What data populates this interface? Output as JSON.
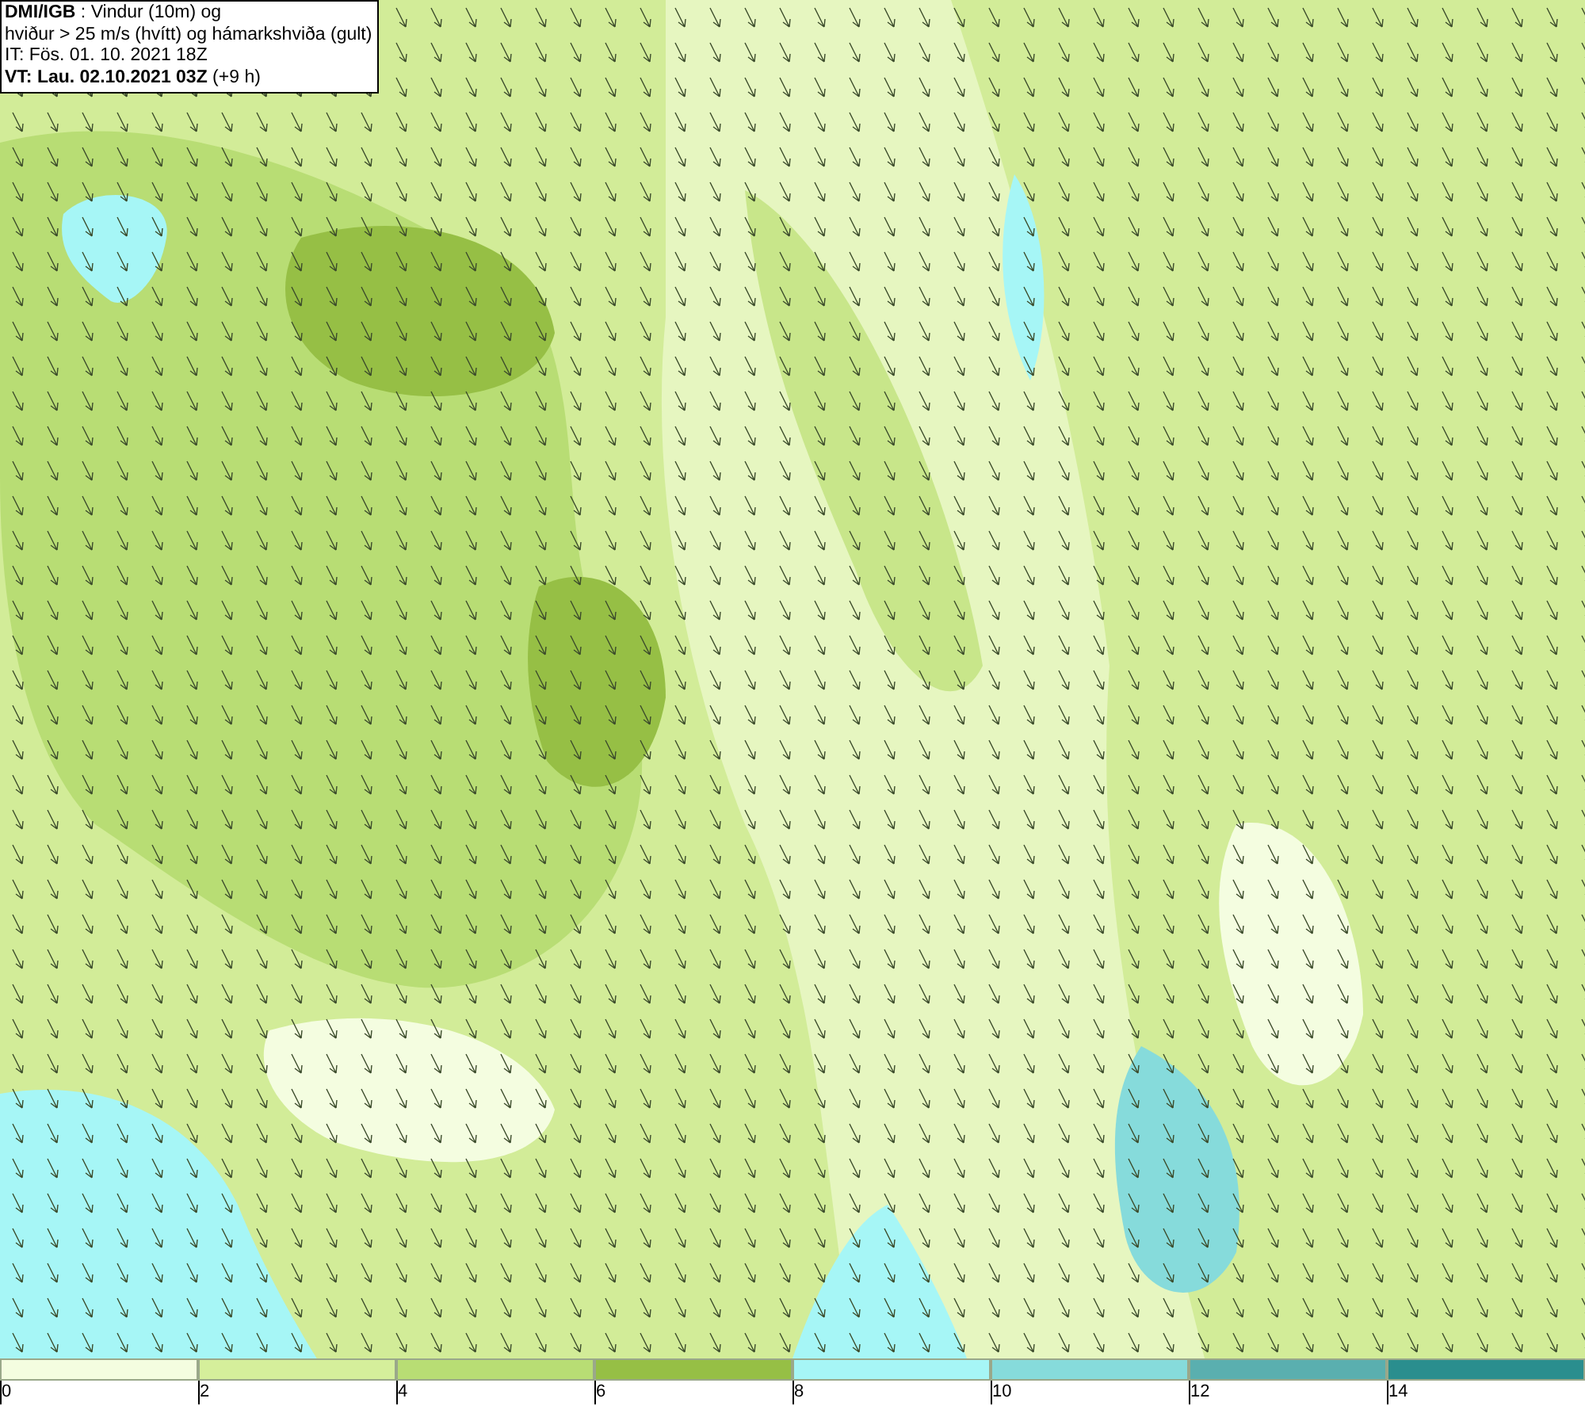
{
  "info_box": {
    "lines": [
      "**DMI/IGB** : Vindur (10m) og",
      "hviður > 25 m/s (hvítt) og hámarkshviða (gult)",
      "IT: Fös. 01. 10. 2021 18Z",
      "**VT: Lau. 02.10.2021 03Z** (+9 h)"
    ]
  },
  "legend": {
    "bins": [
      {
        "label": "0",
        "color": "#f4fde0"
      },
      {
        "label": "2",
        "color": "#d5ef9b"
      },
      {
        "label": "4",
        "color": "#b8dd74"
      },
      {
        "label": "6",
        "color": "#96bf45"
      },
      {
        "label": "8",
        "color": "#a6f6f6"
      },
      {
        "label": "10",
        "color": "#86dbdb"
      },
      {
        "label": "12",
        "color": "#5aafaf"
      },
      {
        "label": "14",
        "color": "#2a8e8e"
      }
    ]
  }
}
